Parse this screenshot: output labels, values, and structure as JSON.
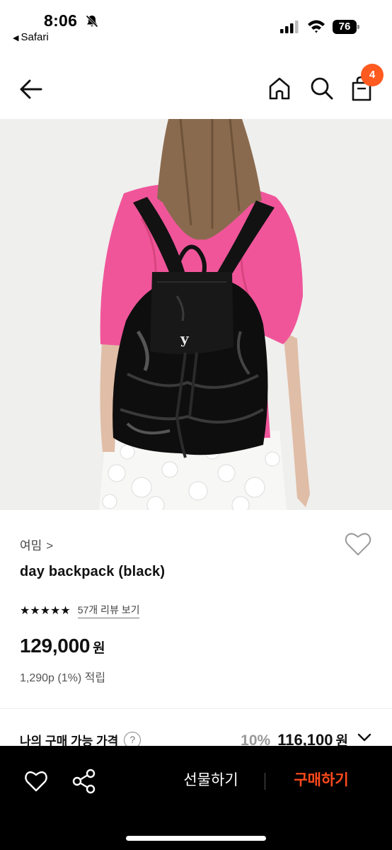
{
  "status_bar": {
    "time": "8:06",
    "back_app_label": "Safari",
    "battery": "76"
  },
  "header": {
    "cart_count": "4"
  },
  "product": {
    "brand": "여밈",
    "brand_chevron": ">",
    "name": "day backpack (black)",
    "stars": "★★★★★",
    "review_link": "57개 리뷰 보기",
    "price": "129,000",
    "price_unit": "원",
    "points": "1,290p (1%) 적립"
  },
  "my_price": {
    "label": "나의 구매 가능 가격",
    "help": "?",
    "discount_rate": "10%",
    "value": "116,100",
    "unit": "원"
  },
  "bottom_bar": {
    "gift_label": "선물하기",
    "buy_label": "구매하기"
  },
  "colors": {
    "accent": "#ff5a1f",
    "buy_text": "#ff4a1c",
    "shirt": "#f0559a",
    "bottom_bar": "#000000"
  },
  "icons": [
    "bell-off-icon",
    "signal-icon",
    "wifi-icon",
    "battery-icon",
    "back-arrow-icon",
    "home-icon",
    "search-icon",
    "shopping-bag-icon",
    "heart-icon",
    "share-icon",
    "chevron-down-icon"
  ]
}
